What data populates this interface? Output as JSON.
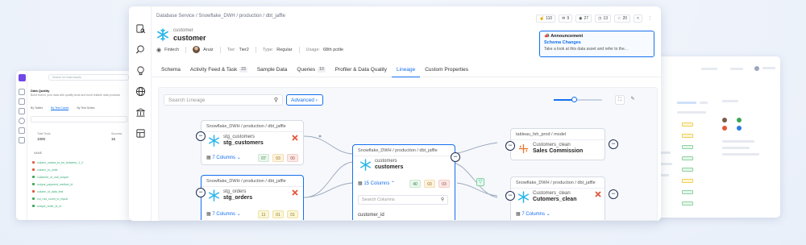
{
  "left_window": {
    "search_placeholder": "Search for Data Assets",
    "heading": "Data Quality",
    "subheading": "Build trust in your data with quality tests and build reliable data products",
    "tabs": [
      "By Tables",
      "By Test Cases",
      "By Test Suites"
    ],
    "total_tests_label": "Total Tests",
    "total_tests_value": "1000",
    "success_label": "Success",
    "success_value": "16",
    "list_header": "NAME",
    "rows": [
      "column_values_to_be_between_1_2",
      "column_to_exist",
      "customer_id_null_unique",
      "unique_payment_method_id",
      "column_id_data_test",
      "col_row_count_to_equal",
      "unique_order_id_rs"
    ]
  },
  "main": {
    "breadcrumb": "Database Service  /  Snowflake_DWH  /  production  /  dbt_jaffle",
    "entity_subtitle": "customer",
    "entity_name": "customer",
    "meta": {
      "domain": "Fintech",
      "owner": "Aruiz",
      "tier_label": "Tier:",
      "tier_value": "Tier2",
      "type_label": "Type:",
      "type_value": "Regular",
      "usage_label": "Usage:",
      "usage_value": "68th pctile"
    },
    "header_buttons": [
      "110",
      "9",
      "27",
      "13",
      "20"
    ],
    "announcement": {
      "title": "Announcement",
      "link": "Schema Changes",
      "description": "Take a look at this data asset and refer to the..."
    },
    "tabs": [
      {
        "label": "Schema",
        "count": ""
      },
      {
        "label": "Activity Feed & Task",
        "count": "23"
      },
      {
        "label": "Sample Data",
        "count": ""
      },
      {
        "label": "Queries",
        "count": "10"
      },
      {
        "label": "Profiler & Data Quality",
        "count": ""
      },
      {
        "label": "Lineage",
        "count": ""
      },
      {
        "label": "Custom Properties",
        "count": ""
      }
    ],
    "lineage": {
      "search_placeholder": "Search Lineage",
      "advanced_label": "Advanced",
      "nodes": {
        "stg_customers": {
          "path": "Snowflake_DWH / production / dbt_jaffle",
          "sub": "stg_customers",
          "name": "stg_customers",
          "cols": "7 Columns",
          "pills": [
            "07",
            "03",
            "00"
          ]
        },
        "stg_orders": {
          "path": "Snowflake_DWH / production / dbt_jaffle",
          "sub": "stg_orders",
          "name": "stg_orders",
          "cols": "7 Columns",
          "pills": [
            "11",
            "01",
            "01"
          ]
        },
        "customers": {
          "path": "Snowflake_DWH / production / dbt_jaffle",
          "sub": "customers",
          "name": "customers",
          "cols": "15 Columns",
          "pills": [
            "40",
            "03",
            "03"
          ],
          "col_search": "Search Columns",
          "first_col": "customer_id"
        },
        "sales": {
          "path": "tableau_fsh_prod  /  model",
          "sub": "Customers_clean",
          "name": "Sales Commission"
        },
        "clean": {
          "path": "Snowflake_DWH / production / dbt_jaffle",
          "sub": "Customers_clean",
          "name": "Cutomers_clean",
          "cols": "7 Columns"
        }
      }
    }
  },
  "colors": {
    "accent": "#1470ef",
    "snowflake": "#29b5e8",
    "danger": "#e2573b",
    "tableau_orange": "#e8762d"
  }
}
